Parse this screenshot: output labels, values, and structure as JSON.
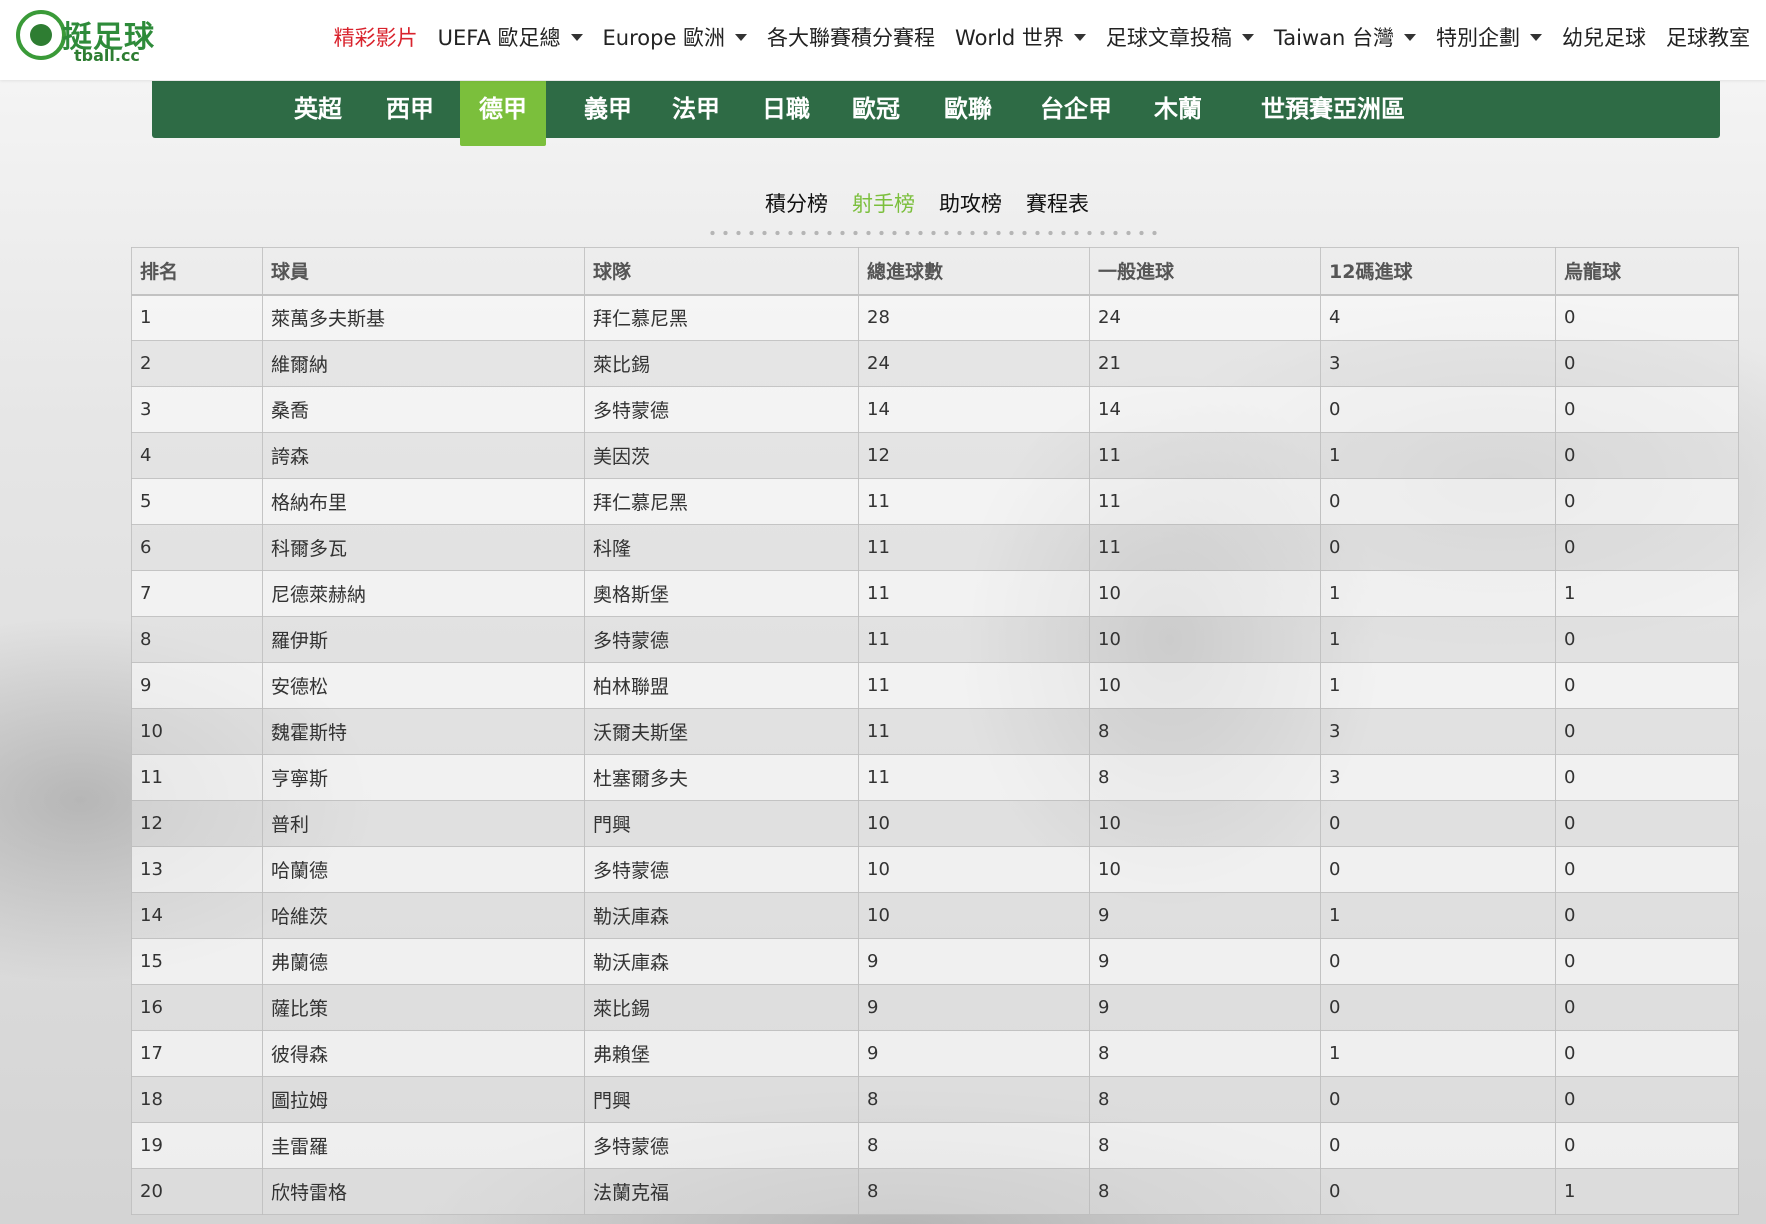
{
  "logo": {
    "text": "挺足球",
    "sub": "tball.cc"
  },
  "topnav": [
    {
      "label": "精彩影片",
      "active": true,
      "dropdown": false
    },
    {
      "label": "UEFA 歐足總",
      "active": false,
      "dropdown": true
    },
    {
      "label": "Europe 歐洲",
      "active": false,
      "dropdown": true
    },
    {
      "label": "各大聯賽積分賽程",
      "active": false,
      "dropdown": false
    },
    {
      "label": "World 世界",
      "active": false,
      "dropdown": true
    },
    {
      "label": "足球文章投稿",
      "active": false,
      "dropdown": true
    },
    {
      "label": "Taiwan 台灣",
      "active": false,
      "dropdown": true
    },
    {
      "label": "特別企劃",
      "active": false,
      "dropdown": true
    },
    {
      "label": "幼兒足球",
      "active": false,
      "dropdown": false
    },
    {
      "label": "足球教室",
      "active": false,
      "dropdown": false
    }
  ],
  "league_tabs": [
    "英超",
    "西甲",
    "德甲",
    "義甲",
    "法甲",
    "日職",
    "歐冠",
    "歐聯",
    "台企甲",
    "木蘭",
    "世預賽亞洲區"
  ],
  "league_active": "德甲",
  "subtabs": [
    "積分榜",
    "射手榜",
    "助攻榜",
    "賽程表"
  ],
  "subtab_active": "射手榜",
  "table": {
    "headers": [
      "排名",
      "球員",
      "球隊",
      "總進球數",
      "一般進球",
      "12碼進球",
      "烏龍球"
    ],
    "rows": [
      [
        "1",
        "萊萬多夫斯基",
        "拜仁慕尼黑",
        "28",
        "24",
        "4",
        "0"
      ],
      [
        "2",
        "維爾納",
        "萊比錫",
        "24",
        "21",
        "3",
        "0"
      ],
      [
        "3",
        "桑喬",
        "多特蒙德",
        "14",
        "14",
        "0",
        "0"
      ],
      [
        "4",
        "誇森",
        "美因茨",
        "12",
        "11",
        "1",
        "0"
      ],
      [
        "5",
        "格納布里",
        "拜仁慕尼黑",
        "11",
        "11",
        "0",
        "0"
      ],
      [
        "6",
        "科爾多瓦",
        "科隆",
        "11",
        "11",
        "0",
        "0"
      ],
      [
        "7",
        "尼德萊赫納",
        "奧格斯堡",
        "11",
        "10",
        "1",
        "1"
      ],
      [
        "8",
        "羅伊斯",
        "多特蒙德",
        "11",
        "10",
        "1",
        "0"
      ],
      [
        "9",
        "安德松",
        "柏林聯盟",
        "11",
        "10",
        "1",
        "0"
      ],
      [
        "10",
        "魏霍斯特",
        "沃爾夫斯堡",
        "11",
        "8",
        "3",
        "0"
      ],
      [
        "11",
        "亨寧斯",
        "杜塞爾多夫",
        "11",
        "8",
        "3",
        "0"
      ],
      [
        "12",
        "普利",
        "門興",
        "10",
        "10",
        "0",
        "0"
      ],
      [
        "13",
        "哈蘭德",
        "多特蒙德",
        "10",
        "10",
        "0",
        "0"
      ],
      [
        "14",
        "哈維茨",
        "勒沃庫森",
        "10",
        "9",
        "1",
        "0"
      ],
      [
        "15",
        "弗蘭德",
        "勒沃庫森",
        "9",
        "9",
        "0",
        "0"
      ],
      [
        "16",
        "薩比策",
        "萊比錫",
        "9",
        "9",
        "0",
        "0"
      ],
      [
        "17",
        "彼得森",
        "弗賴堡",
        "9",
        "8",
        "1",
        "0"
      ],
      [
        "18",
        "圖拉姆",
        "門興",
        "8",
        "8",
        "0",
        "0"
      ],
      [
        "19",
        "圭雷羅",
        "多特蒙德",
        "8",
        "8",
        "0",
        "0"
      ],
      [
        "20",
        "欣特雷格",
        "法蘭克福",
        "8",
        "8",
        "0",
        "1"
      ]
    ]
  },
  "colors": {
    "nav_active": "#d9232d",
    "league_bar": "#2e6b45",
    "accent_green": "#7bbf3c"
  }
}
